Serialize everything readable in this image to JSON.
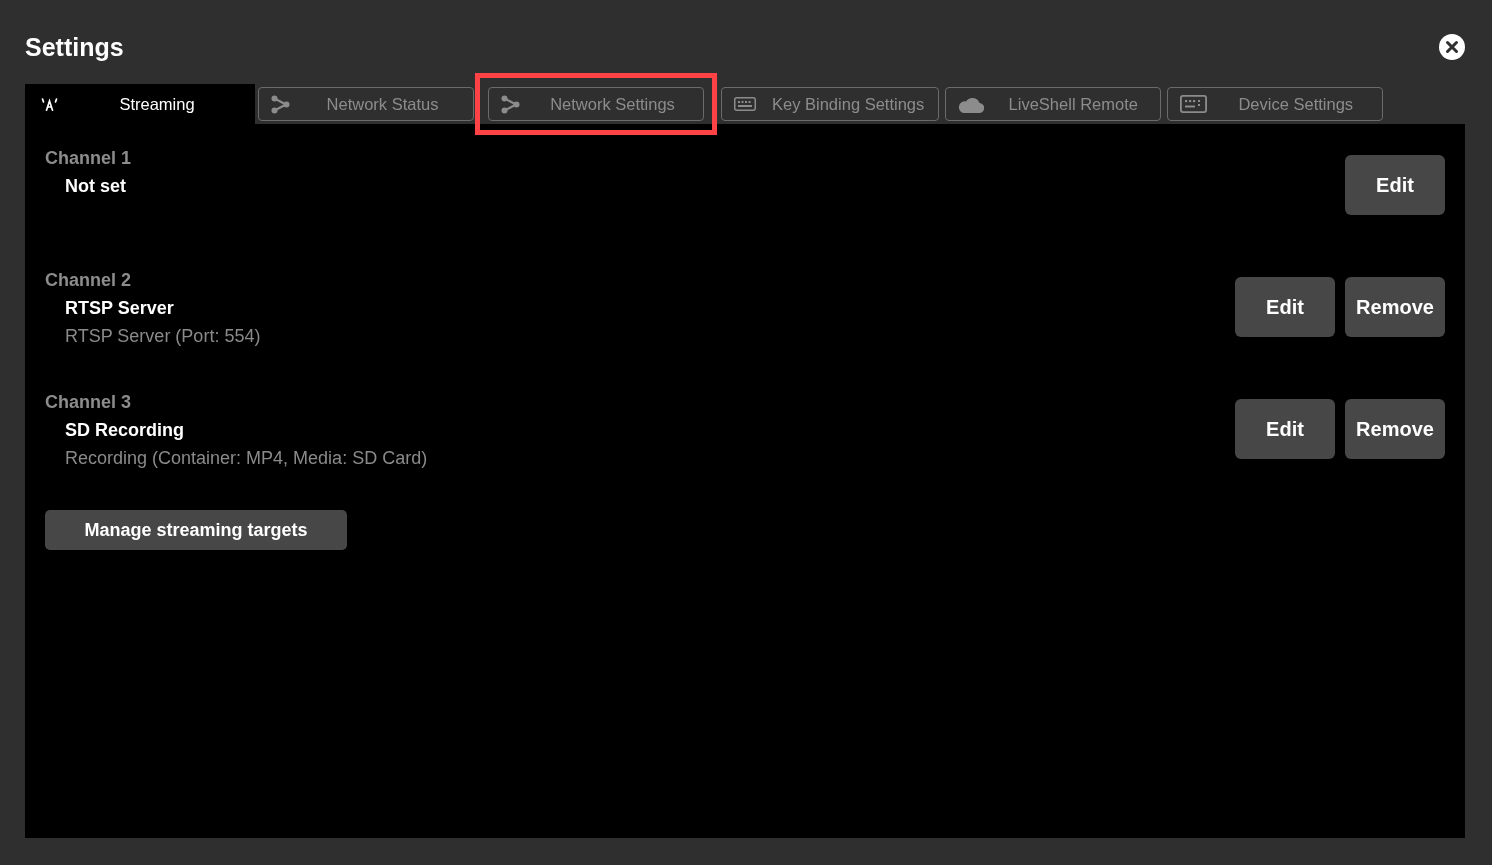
{
  "window": {
    "title": "Settings"
  },
  "tabs": [
    {
      "label": "Streaming",
      "selected": true,
      "highlighted": false
    },
    {
      "label": "Network Status",
      "selected": false,
      "highlighted": false
    },
    {
      "label": "Network Settings",
      "selected": false,
      "highlighted": true
    },
    {
      "label": "Key Binding Settings",
      "selected": false,
      "highlighted": false
    },
    {
      "label": "LiveShell Remote",
      "selected": false,
      "highlighted": false
    },
    {
      "label": "Device Settings",
      "selected": false,
      "highlighted": false
    }
  ],
  "channels": [
    {
      "label": "Channel 1",
      "name": "Not set",
      "buttons": [
        "Edit"
      ]
    },
    {
      "label": "Channel 2",
      "name": "RTSP Server",
      "description": "RTSP Server (Port: 554)",
      "buttons": [
        "Edit",
        "Remove"
      ]
    },
    {
      "label": "Channel 3",
      "name": "SD Recording",
      "description": "Recording (Container: MP4, Media: SD Card)",
      "buttons": [
        "Edit",
        "Remove"
      ]
    }
  ],
  "manage_button": "Manage streaming targets"
}
